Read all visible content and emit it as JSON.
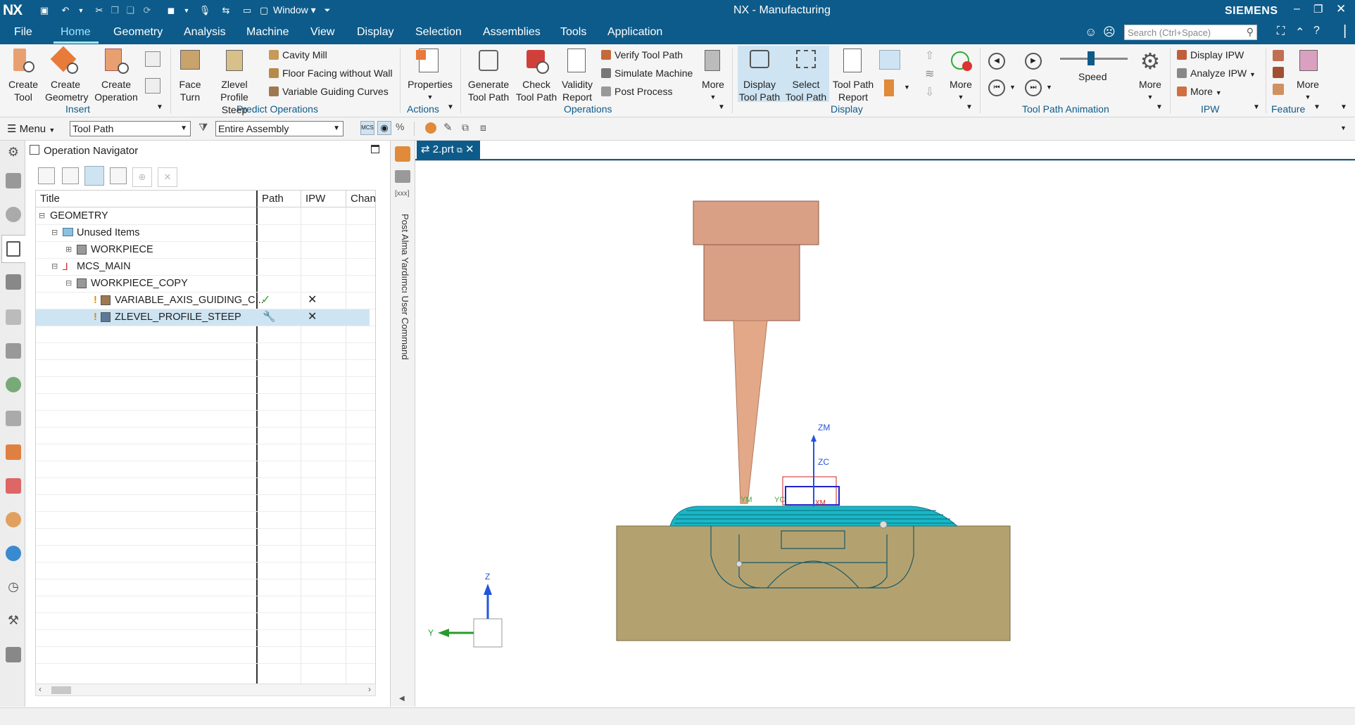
{
  "app": {
    "logo": "NX",
    "title": "NX - Manufacturing",
    "brand": "SIEMENS",
    "window_menu": "Window"
  },
  "menubar": {
    "items": [
      "File",
      "Home",
      "Geometry",
      "Analysis",
      "Machine",
      "View",
      "Display",
      "Selection",
      "Assemblies",
      "Tools",
      "Application"
    ],
    "active": "Home",
    "search_placeholder": "Search (Ctrl+Space)"
  },
  "ribbon": {
    "insert": {
      "create_tool": "Create\nTool",
      "create_tool_l1": "Create",
      "create_tool_l2": "Tool",
      "create_geometry_l1": "Create",
      "create_geometry_l2": "Geometry",
      "create_operation_l1": "Create",
      "create_operation_l2": "Operation",
      "label": "Insert"
    },
    "predict": {
      "face_turn_l1": "Face",
      "face_turn_l2": "Turn",
      "zlevel_l1": "Zlevel",
      "zlevel_l2": "Profile Steep",
      "cavity_mill": "Cavity Mill",
      "floor_facing": "Floor Facing without Wall",
      "variable_guiding": "Variable Guiding Curves",
      "label": "Predict Operations"
    },
    "actions": {
      "properties": "Properties",
      "label": "Actions"
    },
    "operations": {
      "generate_l1": "Generate",
      "generate_l2": "Tool Path",
      "check_l1": "Check",
      "check_l2": "Tool Path",
      "validity_l1": "Validity",
      "validity_l2": "Report",
      "verify": "Verify Tool Path",
      "simulate": "Simulate Machine",
      "post": "Post Process",
      "more": "More",
      "label": "Operations"
    },
    "display": {
      "display_l1": "Display",
      "display_l2": "Tool Path",
      "select_l1": "Select",
      "select_l2": "Tool Path",
      "report_l1": "Tool Path",
      "report_l2": "Report",
      "more": "More",
      "label": "Display"
    },
    "animation": {
      "speed": "Speed",
      "speed_level": 0.45,
      "more": "More",
      "label": "Tool Path Animation"
    },
    "ipw": {
      "display_ipw": "Display IPW",
      "analyze_ipw": "Analyze IPW",
      "more": "More",
      "label": "IPW"
    },
    "feature": {
      "more": "More",
      "label": "Feature"
    }
  },
  "secondary": {
    "menu": "Menu",
    "filter": "Tool Path",
    "scope": "Entire Assembly"
  },
  "navigator": {
    "title": "Operation Navigator",
    "columns": [
      "Title",
      "Path",
      "IPW",
      "Chan"
    ],
    "rows": [
      {
        "label": "GEOMETRY",
        "path": "",
        "ipw": ""
      },
      {
        "label": "Unused Items",
        "path": "",
        "ipw": ""
      },
      {
        "label": "WORKPIECE",
        "path": "",
        "ipw": ""
      },
      {
        "label": "MCS_MAIN",
        "path": "",
        "ipw": ""
      },
      {
        "label": "WORKPIECE_COPY",
        "path": "",
        "ipw": ""
      },
      {
        "label": "VARIABLE_AXIS_GUIDING_C...",
        "path": "✓",
        "ipw": "✕"
      },
      {
        "label": "ZLEVEL_PROFILE_STEEP",
        "path": "wrench",
        "ipw": "✕"
      }
    ]
  },
  "side_panel": {
    "label": "Post Alma Yardımcı  User Command"
  },
  "viewport": {
    "tab": "2.prt",
    "axis_labels": {
      "zm": "ZM",
      "zc": "ZC",
      "ym": "YM",
      "yc": "YC",
      "xm": "XM"
    },
    "triad": {
      "z": "Z",
      "y": "Y"
    }
  },
  "colors": {
    "titlebar": "#0d5b8a",
    "tool_body": "#d9a085",
    "stock": "#b3a270",
    "toolpath": "#19b7c7",
    "accent_check": "#2aa52a"
  }
}
